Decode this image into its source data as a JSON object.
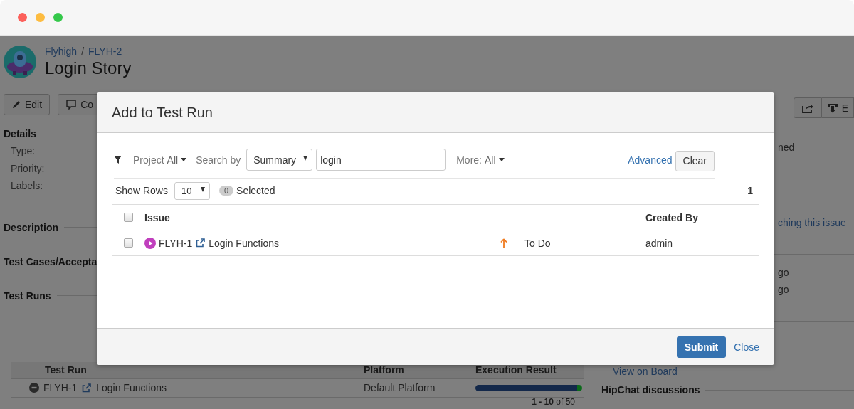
{
  "window": {
    "traffic_lights": [
      {
        "color": "#fc605b"
      },
      {
        "color": "#fdbc40"
      },
      {
        "color": "#34c84a"
      }
    ]
  },
  "issue": {
    "breadcrumbs": [
      "Flyhigh",
      "FLYH-2"
    ],
    "breadcrumb_separator": "/",
    "title": "Login Story"
  },
  "toolbar": {
    "left": [
      {
        "kind": "edit",
        "label": "Edit"
      },
      {
        "kind": "comment",
        "label": "Co"
      }
    ],
    "right": [
      {
        "kind": "share"
      },
      {
        "kind": "export",
        "label": "E"
      }
    ]
  },
  "details": {
    "heading": "Details",
    "fields": [
      "Type:",
      "Priority:",
      "Labels:"
    ]
  },
  "sections": [
    "Description",
    "Test Cases/Accepta",
    "Test Runs"
  ],
  "test_runs": {
    "columns": [
      "Test Run",
      "Platform",
      "Execution Result"
    ],
    "rows": [
      {
        "key": "FLYH-1",
        "summary": "Login Functions",
        "platform": "Default Platform",
        "result": [
          {
            "color": "#13284a",
            "level": 0.95
          },
          {
            "color": "#0b6a1a",
            "level": 0.05
          }
        ]
      }
    ],
    "pagination": "**1 - 10** of 50"
  },
  "right_panel": [
    {
      "kind": "text",
      "text": "ned"
    },
    {
      "kind": "link",
      "text": "ching this issue"
    },
    {
      "kind": "text",
      "text": "go"
    },
    {
      "kind": "text",
      "text": "go"
    },
    {
      "kind": "board",
      "text": "View on Board"
    },
    {
      "kind": "heading",
      "text": "HipChat discussions"
    }
  ],
  "dialog": {
    "title": "Add to Test Run",
    "filters": {
      "project_label": "Project",
      "project_value": "All",
      "search_by_label": "Search by",
      "search_by_value": "Summary",
      "query": "login",
      "more_label": "More:",
      "more_value": "All",
      "advanced": "Advanced",
      "clear": "Clear"
    },
    "paging": {
      "show_rows_label": "Show Rows",
      "rows_value": "10",
      "selected_count": "0",
      "selected_label": "Selected",
      "total": "1"
    },
    "table": {
      "select_all_checked": false,
      "columns": {
        "issue": "Issue",
        "created_by": "Created By"
      },
      "rows": [
        {
          "checked": false,
          "key": "FLYH-1",
          "summary": "Login Functions",
          "status": "To Do",
          "created_by": "admin"
        }
      ]
    },
    "buttons": {
      "submit": "Submit",
      "close": "Close"
    }
  }
}
